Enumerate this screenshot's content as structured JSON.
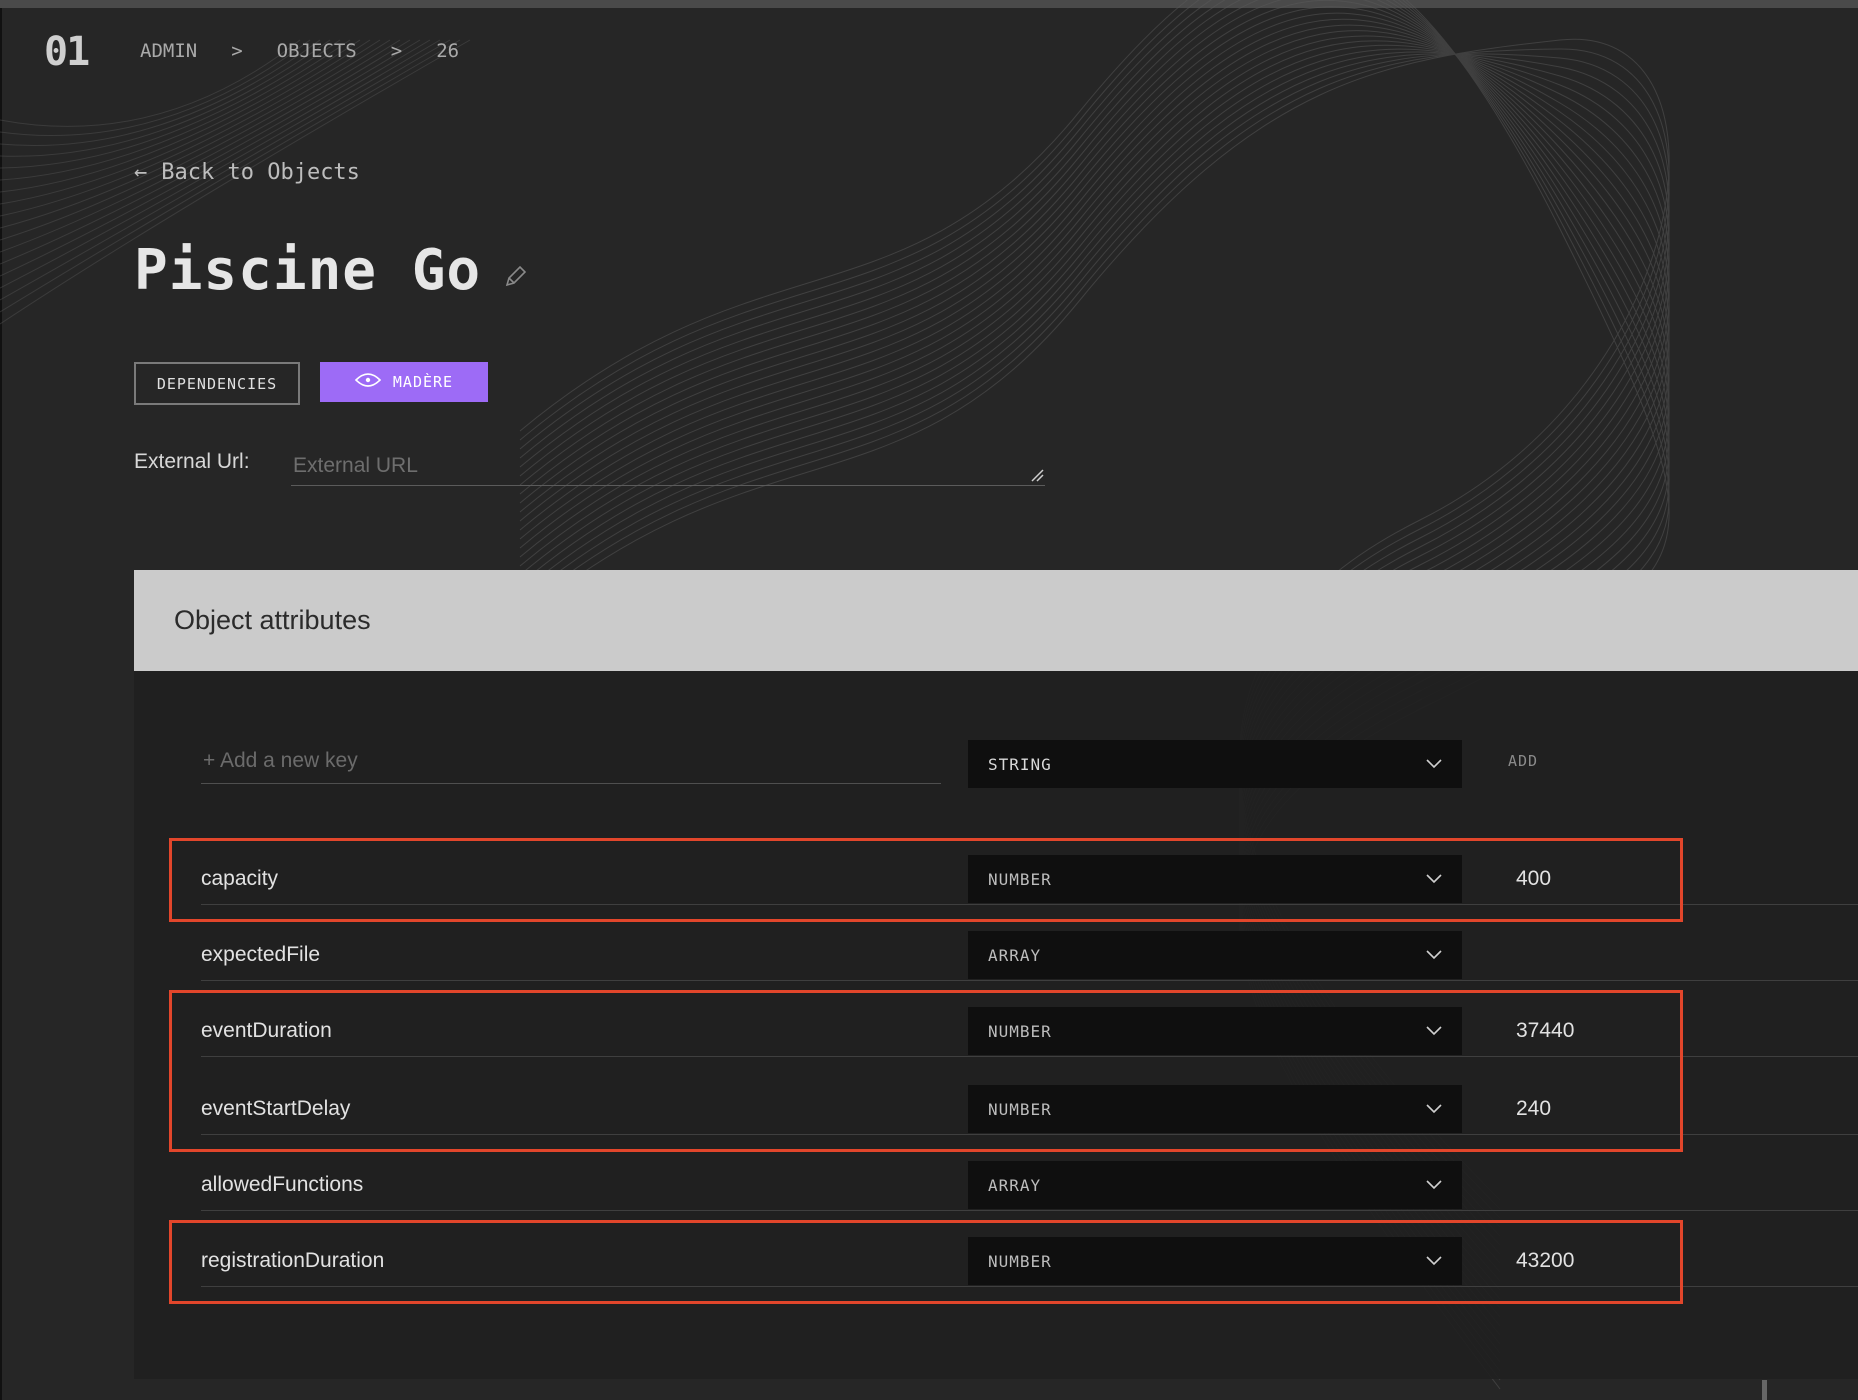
{
  "header": {
    "logo": "01",
    "breadcrumb": [
      "ADMIN",
      "OBJECTS",
      "26"
    ],
    "separator": ">"
  },
  "back_link": "Back to Objects",
  "page_title": "Piscine Go",
  "buttons": {
    "dependencies": "DEPENDENCIES",
    "madere": "MADÈRE"
  },
  "external_url": {
    "label": "External Url:",
    "placeholder": "External URL",
    "value": ""
  },
  "attributes": {
    "title": "Object attributes",
    "new_key": {
      "placeholder": "+ Add a new key",
      "type": "STRING",
      "add_label": "ADD"
    },
    "rows": [
      {
        "key": "capacity",
        "type": "NUMBER",
        "value": "400",
        "highlighted": true
      },
      {
        "key": "expectedFile",
        "type": "ARRAY",
        "value": "",
        "highlighted": false
      },
      {
        "key": "eventDuration",
        "type": "NUMBER",
        "value": "37440",
        "highlighted": true
      },
      {
        "key": "eventStartDelay",
        "type": "NUMBER",
        "value": "240",
        "highlighted": true
      },
      {
        "key": "allowedFunctions",
        "type": "ARRAY",
        "value": "",
        "highlighted": false
      },
      {
        "key": "registrationDuration",
        "type": "NUMBER",
        "value": "43200",
        "highlighted": true
      }
    ]
  },
  "colors": {
    "accent": "#9d6bf6",
    "highlight": "#e2462b",
    "background": "#262626"
  }
}
